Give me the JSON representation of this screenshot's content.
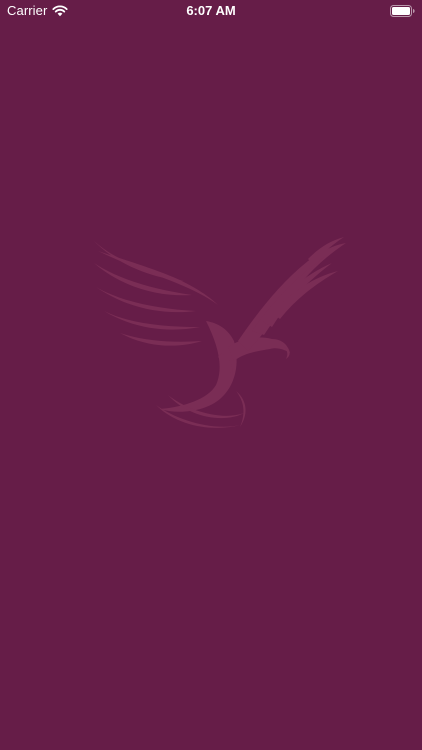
{
  "status_bar": {
    "carrier": "Carrier",
    "time": "6:07 AM",
    "wifi_icon": "wifi-icon",
    "battery_icon": "battery-icon"
  },
  "splash": {
    "logo_icon": "eagle-logo-icon"
  },
  "colors": {
    "background": "#661d48",
    "logo": "#7a2d55",
    "status_text": "#ffffff"
  }
}
